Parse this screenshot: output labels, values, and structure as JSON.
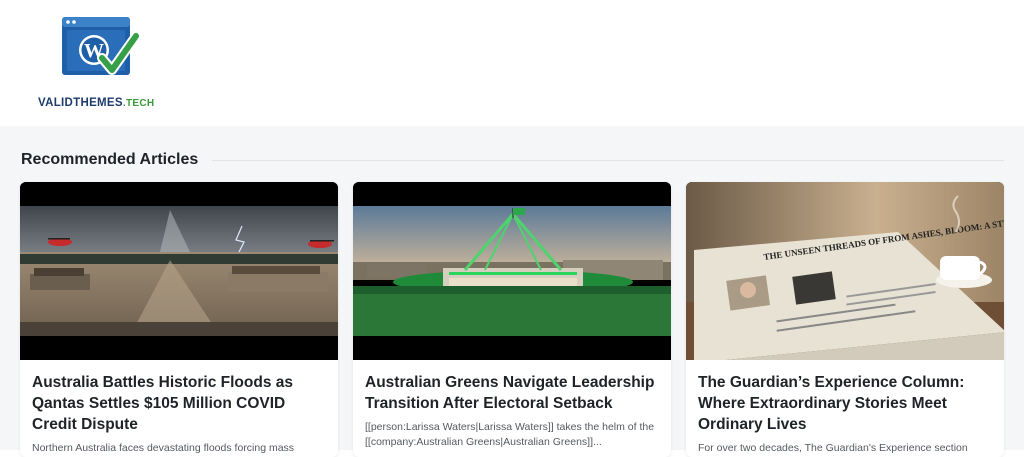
{
  "site": {
    "logo_text_main": "VALIDTHEMES",
    "logo_text_tld": ".TECH",
    "brand_blue": "#1d3b6b",
    "brand_green": "#3a9a3a"
  },
  "section": {
    "title": "Recommended Articles"
  },
  "articles": [
    {
      "title": "Australia Battles Historic Floods as Qantas Settles $105 Million COVID Credit Dispute",
      "excerpt": "Northern Australia faces devastating floods forcing mass"
    },
    {
      "title": "Australian Greens Navigate Leadership Transition After Electoral Setback",
      "excerpt": "[[person:Larissa Waters|Larissa Waters]] takes the helm of the [[company:Australian Greens|Australian Greens]]..."
    },
    {
      "title": "The Guardian’s Experience Column: Where Extraordinary Stories Meet Ordinary Lives",
      "excerpt": "For over two decades, The Guardian's Experience section"
    }
  ],
  "newspaper_headline": "THE UNSEEN THREADS OF FROM ASHES, BLOOM: A STRANGER'S LEGACY"
}
